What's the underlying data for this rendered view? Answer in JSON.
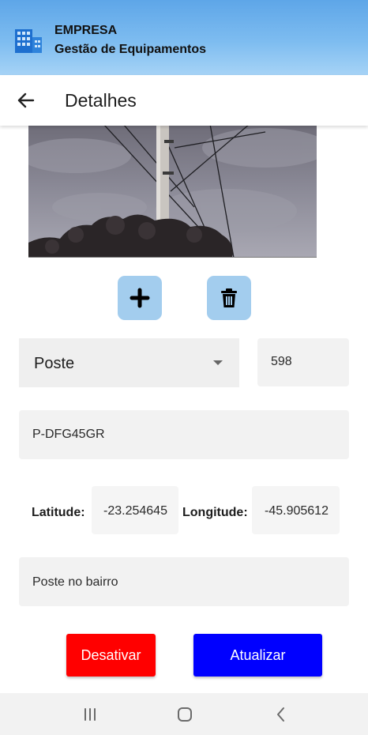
{
  "header": {
    "company": "EMPRESA",
    "subtitle": "Gestão de Equipamentos",
    "logo_icon": "building-icon",
    "gradient": [
      "#5ea6e8",
      "#a6d3f6"
    ]
  },
  "toolbar": {
    "back_icon": "arrow-left-icon",
    "title": "Detalhes"
  },
  "photo": {
    "description": "photo-of-utility-pole"
  },
  "photo_actions": {
    "add_icon": "plus-icon",
    "delete_icon": "trash-icon",
    "button_color": "#a3cdee"
  },
  "form": {
    "type_selected": "Poste",
    "number": "598",
    "code": "P-DFG45GR",
    "latitude_label": "Latitude:",
    "latitude": "-23.254645",
    "longitude_label": "Longitude:",
    "longitude": "-45.905612",
    "description": "Poste no bairro"
  },
  "actions": {
    "deactivate_label": "Desativar",
    "deactivate_color": "#ff0000",
    "update_label": "Atualizar",
    "update_color": "#0000ff"
  },
  "system_nav": {
    "recents_icon": "recents-icon",
    "home_icon": "home-icon",
    "back_icon": "chevron-left-icon"
  }
}
